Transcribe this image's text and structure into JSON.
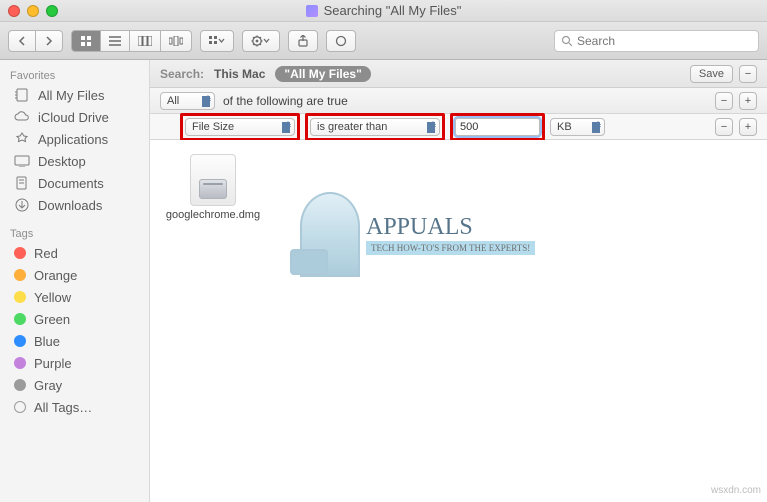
{
  "window": {
    "title": "Searching \"All My Files\""
  },
  "search": {
    "placeholder": "Search"
  },
  "sidebar": {
    "favorites_header": "Favorites",
    "tags_header": "Tags",
    "favorites": [
      {
        "label": "All My Files"
      },
      {
        "label": "iCloud Drive"
      },
      {
        "label": "Applications"
      },
      {
        "label": "Desktop"
      },
      {
        "label": "Documents"
      },
      {
        "label": "Downloads"
      }
    ],
    "tags": [
      {
        "label": "Red"
      },
      {
        "label": "Orange"
      },
      {
        "label": "Yellow"
      },
      {
        "label": "Green"
      },
      {
        "label": "Blue"
      },
      {
        "label": "Purple"
      },
      {
        "label": "Gray"
      },
      {
        "label": "All Tags…"
      }
    ]
  },
  "scope": {
    "label": "Search:",
    "this_mac": "This Mac",
    "all_my_files": "\"All My Files\"",
    "save": "Save",
    "minus": "−"
  },
  "criteria": {
    "top_scope": "All",
    "top_text": "of the following are true",
    "attr": "File Size",
    "op": "is greater than",
    "value": "500",
    "unit": "KB",
    "minus": "−",
    "plus": "+"
  },
  "files": {
    "item1": "googlechrome.dmg"
  },
  "watermark": {
    "title": "APPUALS",
    "sub": "TECH HOW-TO'S FROM THE EXPERTS!"
  },
  "footer": {
    "site": "wsxdn.com"
  }
}
